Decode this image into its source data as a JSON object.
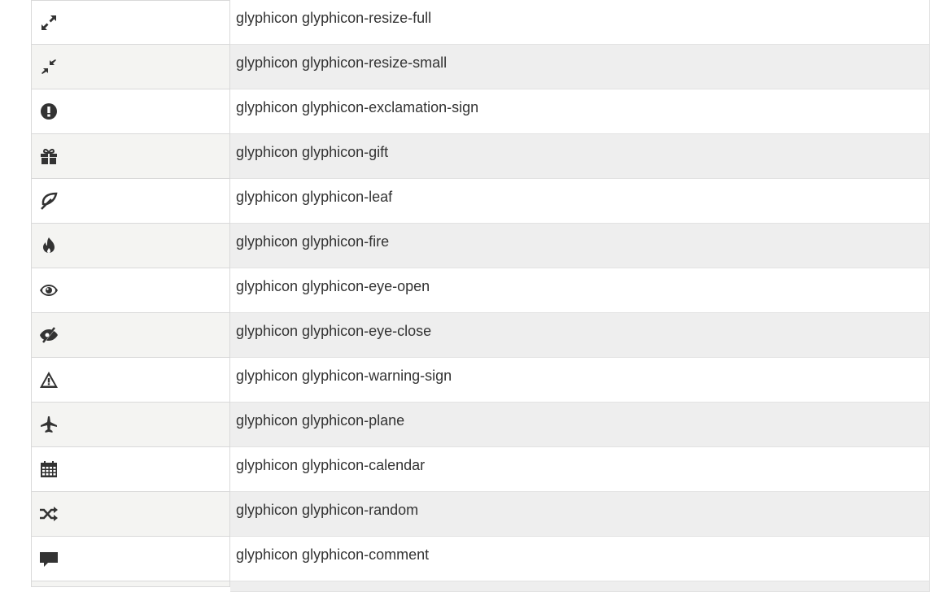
{
  "rows": [
    {
      "class_name": "glyphicon glyphicon-resize-full",
      "icon": "resize-full-icon"
    },
    {
      "class_name": "glyphicon glyphicon-resize-small",
      "icon": "resize-small-icon"
    },
    {
      "class_name": "glyphicon glyphicon-exclamation-sign",
      "icon": "exclamation-sign-icon"
    },
    {
      "class_name": "glyphicon glyphicon-gift",
      "icon": "gift-icon"
    },
    {
      "class_name": "glyphicon glyphicon-leaf",
      "icon": "leaf-icon"
    },
    {
      "class_name": "glyphicon glyphicon-fire",
      "icon": "fire-icon"
    },
    {
      "class_name": "glyphicon glyphicon-eye-open",
      "icon": "eye-open-icon"
    },
    {
      "class_name": "glyphicon glyphicon-eye-close",
      "icon": "eye-close-icon"
    },
    {
      "class_name": "glyphicon glyphicon-warning-sign",
      "icon": "warning-sign-icon"
    },
    {
      "class_name": "glyphicon glyphicon-plane",
      "icon": "plane-icon"
    },
    {
      "class_name": "glyphicon glyphicon-calendar",
      "icon": "calendar-icon"
    },
    {
      "class_name": "glyphicon glyphicon-random",
      "icon": "random-icon"
    },
    {
      "class_name": "glyphicon glyphicon-comment",
      "icon": "comment-icon"
    }
  ],
  "colors": {
    "icon": "#333333",
    "text": "#333333",
    "stripe": "#eeeeee",
    "icon_stripe": "#f4f4f2",
    "border": "#d9d9d9"
  }
}
